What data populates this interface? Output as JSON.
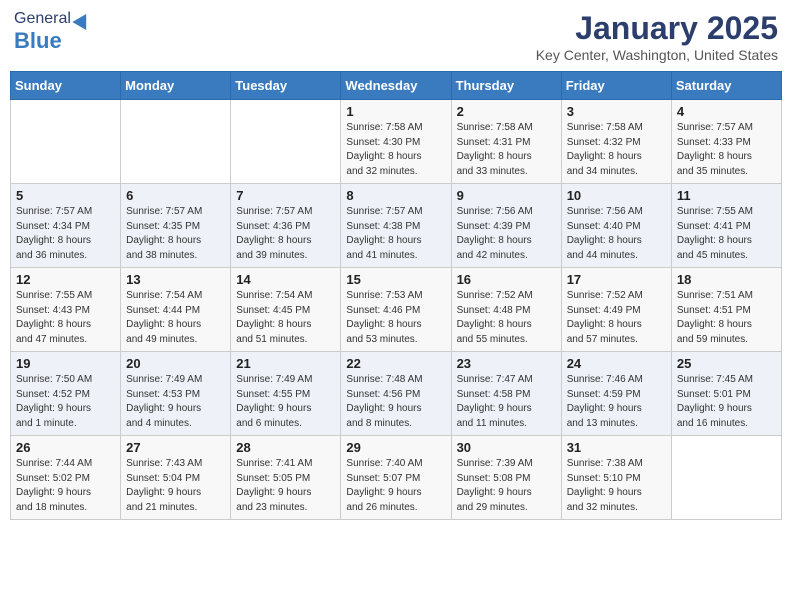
{
  "header": {
    "logo_general": "General",
    "logo_blue": "Blue",
    "month": "January 2025",
    "location": "Key Center, Washington, United States"
  },
  "weekdays": [
    "Sunday",
    "Monday",
    "Tuesday",
    "Wednesday",
    "Thursday",
    "Friday",
    "Saturday"
  ],
  "weeks": [
    [
      {
        "day": "",
        "info": ""
      },
      {
        "day": "",
        "info": ""
      },
      {
        "day": "",
        "info": ""
      },
      {
        "day": "1",
        "info": "Sunrise: 7:58 AM\nSunset: 4:30 PM\nDaylight: 8 hours\nand 32 minutes."
      },
      {
        "day": "2",
        "info": "Sunrise: 7:58 AM\nSunset: 4:31 PM\nDaylight: 8 hours\nand 33 minutes."
      },
      {
        "day": "3",
        "info": "Sunrise: 7:58 AM\nSunset: 4:32 PM\nDaylight: 8 hours\nand 34 minutes."
      },
      {
        "day": "4",
        "info": "Sunrise: 7:57 AM\nSunset: 4:33 PM\nDaylight: 8 hours\nand 35 minutes."
      }
    ],
    [
      {
        "day": "5",
        "info": "Sunrise: 7:57 AM\nSunset: 4:34 PM\nDaylight: 8 hours\nand 36 minutes."
      },
      {
        "day": "6",
        "info": "Sunrise: 7:57 AM\nSunset: 4:35 PM\nDaylight: 8 hours\nand 38 minutes."
      },
      {
        "day": "7",
        "info": "Sunrise: 7:57 AM\nSunset: 4:36 PM\nDaylight: 8 hours\nand 39 minutes."
      },
      {
        "day": "8",
        "info": "Sunrise: 7:57 AM\nSunset: 4:38 PM\nDaylight: 8 hours\nand 41 minutes."
      },
      {
        "day": "9",
        "info": "Sunrise: 7:56 AM\nSunset: 4:39 PM\nDaylight: 8 hours\nand 42 minutes."
      },
      {
        "day": "10",
        "info": "Sunrise: 7:56 AM\nSunset: 4:40 PM\nDaylight: 8 hours\nand 44 minutes."
      },
      {
        "day": "11",
        "info": "Sunrise: 7:55 AM\nSunset: 4:41 PM\nDaylight: 8 hours\nand 45 minutes."
      }
    ],
    [
      {
        "day": "12",
        "info": "Sunrise: 7:55 AM\nSunset: 4:43 PM\nDaylight: 8 hours\nand 47 minutes."
      },
      {
        "day": "13",
        "info": "Sunrise: 7:54 AM\nSunset: 4:44 PM\nDaylight: 8 hours\nand 49 minutes."
      },
      {
        "day": "14",
        "info": "Sunrise: 7:54 AM\nSunset: 4:45 PM\nDaylight: 8 hours\nand 51 minutes."
      },
      {
        "day": "15",
        "info": "Sunrise: 7:53 AM\nSunset: 4:46 PM\nDaylight: 8 hours\nand 53 minutes."
      },
      {
        "day": "16",
        "info": "Sunrise: 7:52 AM\nSunset: 4:48 PM\nDaylight: 8 hours\nand 55 minutes."
      },
      {
        "day": "17",
        "info": "Sunrise: 7:52 AM\nSunset: 4:49 PM\nDaylight: 8 hours\nand 57 minutes."
      },
      {
        "day": "18",
        "info": "Sunrise: 7:51 AM\nSunset: 4:51 PM\nDaylight: 8 hours\nand 59 minutes."
      }
    ],
    [
      {
        "day": "19",
        "info": "Sunrise: 7:50 AM\nSunset: 4:52 PM\nDaylight: 9 hours\nand 1 minute."
      },
      {
        "day": "20",
        "info": "Sunrise: 7:49 AM\nSunset: 4:53 PM\nDaylight: 9 hours\nand 4 minutes."
      },
      {
        "day": "21",
        "info": "Sunrise: 7:49 AM\nSunset: 4:55 PM\nDaylight: 9 hours\nand 6 minutes."
      },
      {
        "day": "22",
        "info": "Sunrise: 7:48 AM\nSunset: 4:56 PM\nDaylight: 9 hours\nand 8 minutes."
      },
      {
        "day": "23",
        "info": "Sunrise: 7:47 AM\nSunset: 4:58 PM\nDaylight: 9 hours\nand 11 minutes."
      },
      {
        "day": "24",
        "info": "Sunrise: 7:46 AM\nSunset: 4:59 PM\nDaylight: 9 hours\nand 13 minutes."
      },
      {
        "day": "25",
        "info": "Sunrise: 7:45 AM\nSunset: 5:01 PM\nDaylight: 9 hours\nand 16 minutes."
      }
    ],
    [
      {
        "day": "26",
        "info": "Sunrise: 7:44 AM\nSunset: 5:02 PM\nDaylight: 9 hours\nand 18 minutes."
      },
      {
        "day": "27",
        "info": "Sunrise: 7:43 AM\nSunset: 5:04 PM\nDaylight: 9 hours\nand 21 minutes."
      },
      {
        "day": "28",
        "info": "Sunrise: 7:41 AM\nSunset: 5:05 PM\nDaylight: 9 hours\nand 23 minutes."
      },
      {
        "day": "29",
        "info": "Sunrise: 7:40 AM\nSunset: 5:07 PM\nDaylight: 9 hours\nand 26 minutes."
      },
      {
        "day": "30",
        "info": "Sunrise: 7:39 AM\nSunset: 5:08 PM\nDaylight: 9 hours\nand 29 minutes."
      },
      {
        "day": "31",
        "info": "Sunrise: 7:38 AM\nSunset: 5:10 PM\nDaylight: 9 hours\nand 32 minutes."
      },
      {
        "day": "",
        "info": ""
      }
    ]
  ]
}
